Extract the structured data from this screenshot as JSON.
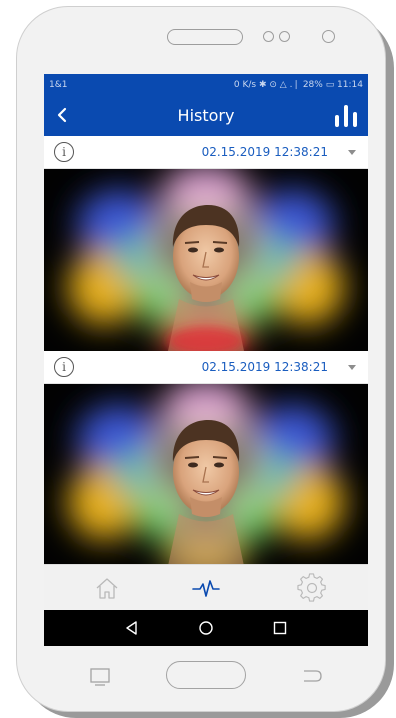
{
  "status_bar": {
    "carrier": "1&1",
    "indicators": "0 K/s ✱ ⊙ △ .❘ 28% ▭ 11:14"
  },
  "app_bar": {
    "title": "History",
    "back_icon": "chevron-left-icon",
    "action_icon": "stats-bars-icon"
  },
  "history": {
    "entries": [
      {
        "date": "02.15.2019 12:38:21",
        "info_glyph": "i"
      },
      {
        "date": "02.15.2019 12:38:21",
        "info_glyph": "i"
      }
    ]
  },
  "bottom_nav": {
    "items": [
      {
        "icon": "home-icon",
        "active": false
      },
      {
        "icon": "pulse-icon",
        "active": true
      },
      {
        "icon": "gear-icon",
        "active": false
      }
    ]
  },
  "colors": {
    "primary": "#0a4ab0",
    "date_text": "#1a5dbf",
    "inactive_icon": "#b9b9b9"
  }
}
